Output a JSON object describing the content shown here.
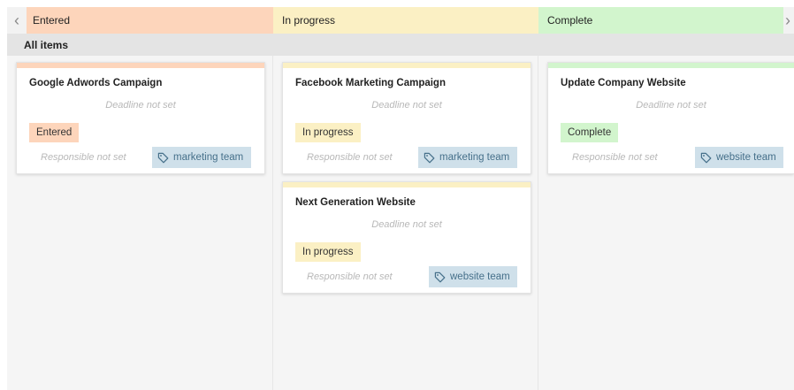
{
  "columns": [
    {
      "label": "Entered",
      "color": "#fdd5bb"
    },
    {
      "label": "In progress",
      "color": "#fbf0c4"
    },
    {
      "label": "Complete",
      "color": "#d2f5cd"
    }
  ],
  "nav": {
    "prev_icon": "chevron-left-icon",
    "next_icon": "chevron-right-icon"
  },
  "group": {
    "label": "All items"
  },
  "cards": [
    {
      "title": "Google Adwords Campaign",
      "deadline": "Deadline not set",
      "status": "Entered",
      "status_color": "#fdd5bb",
      "responsible": "Responsible not set",
      "tag": "marketing team"
    },
    {
      "title": "Facebook Marketing Campaign",
      "deadline": "Deadline not set",
      "status": "In progress",
      "status_color": "#fbf0c4",
      "responsible": "Responsible not set",
      "tag": "marketing team"
    },
    {
      "title": "Next Generation Website",
      "deadline": "Deadline not set",
      "status": "In progress",
      "status_color": "#fbf0c4",
      "responsible": "Responsible not set",
      "tag": "website team"
    },
    {
      "title": "Update Company Website",
      "deadline": "Deadline not set",
      "status": "Complete",
      "status_color": "#d2f5cd",
      "responsible": "Responsible not set",
      "tag": "website team"
    }
  ]
}
